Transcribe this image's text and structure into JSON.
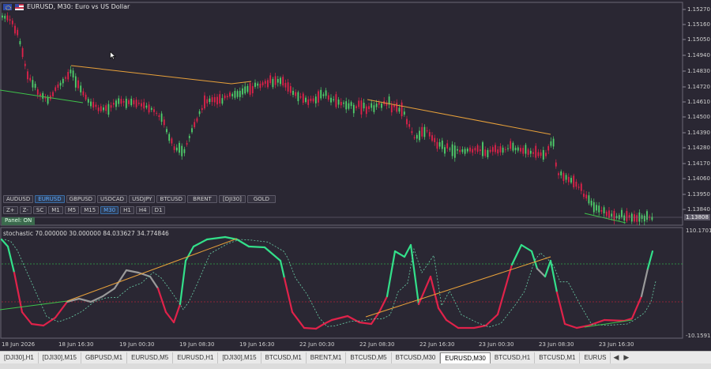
{
  "chart": {
    "symbol_title": "EURUSD, M30:  Euro vs US Dollar",
    "colors": {
      "background": "#2a2733",
      "bull": "#4fd16b",
      "bear": "#e0224a",
      "trend_orange": "#e8a13a",
      "trend_green": "#3ec24a",
      "stoch_main_up": "#33e08a",
      "stoch_main_down": "#e0224a",
      "stoch_main_flat": "#9a9a9a",
      "stoch_signal": "#6bd0a8",
      "level_green": "#2faa4a",
      "level_red": "#b0243a"
    },
    "price_axis": [
      "1.15270",
      "1.15160",
      "1.15050",
      "1.14940",
      "1.14830",
      "1.14720",
      "1.14610",
      "1.14500",
      "1.14390",
      "1.14280",
      "1.14170",
      "1.14060",
      "1.13950",
      "1.13840"
    ],
    "current_price": "1.13808"
  },
  "symbols": [
    "AUDUSD",
    "EURUSD",
    "GBPUSD",
    "USDCAD",
    "USDJPY",
    "BTCUSD",
    "BRENT",
    "[DJI30]",
    "GOLD"
  ],
  "active_symbol": "EURUSD",
  "timeframes": [
    "Z+",
    "Z-",
    "SC",
    "M1",
    "M5",
    "M15",
    "M30",
    "H1",
    "H4",
    "D1"
  ],
  "active_timeframe": "M30",
  "panel_label": "Panel: ON",
  "oscillator": {
    "label": "stochastic  70.000000 30.000000 84.033627 34.774846",
    "axis_top": "110.1701",
    "axis_bottom": "-10.1591"
  },
  "time_axis": [
    "18 Jun 2026",
    "18 Jun 16:30",
    "19 Jun 00:30",
    "19 Jun 08:30",
    "19 Jun 16:30",
    "22 Jun 00:30",
    "22 Jun 08:30",
    "22 Jun 16:30",
    "23 Jun 00:30",
    "23 Jun 08:30",
    "23 Jun 16:30"
  ],
  "tabs": [
    "[DJI30],H1",
    "[DJI30],M15",
    "GBPUSD,M1",
    "EURUSD,M5",
    "EURUSD,H1",
    "[DJI30],M15",
    "BTCUSD,M1",
    "BRENT,M1",
    "BTCUSD,M5",
    "BTCUSD,M30",
    "EURUSD,M30",
    "BTCUSD,H1",
    "BTCUSD,M1",
    "EURUS"
  ],
  "active_tab": "EURUSD,M30"
}
